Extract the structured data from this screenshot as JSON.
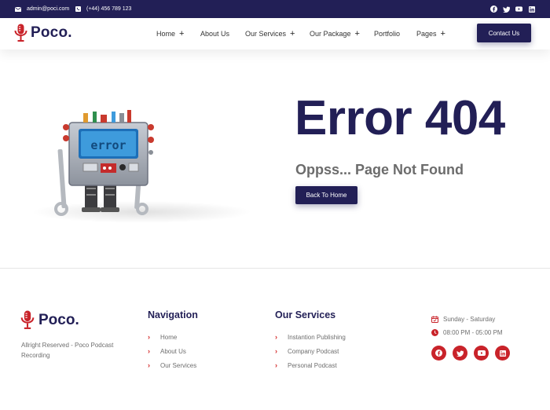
{
  "topbar": {
    "email": "admin@poci.com",
    "phone": "(+44) 456 789 123",
    "social_icons": [
      "facebook-icon",
      "twitter-icon",
      "youtube-icon",
      "linkedin-icon"
    ]
  },
  "header": {
    "brand": "Poco.",
    "nav": [
      {
        "label": "Home",
        "has_dropdown": true
      },
      {
        "label": "About Us",
        "has_dropdown": false
      },
      {
        "label": "Our Services",
        "has_dropdown": true
      },
      {
        "label": "Our Package",
        "has_dropdown": true
      },
      {
        "label": "Portfolio",
        "has_dropdown": false
      },
      {
        "label": "Pages",
        "has_dropdown": true
      }
    ],
    "cta_label": "Contact Us"
  },
  "hero": {
    "title": "Error 404",
    "subtitle": "Oppss... Page Not Found",
    "button_label": "Back To Home",
    "robot_screen_text": "error"
  },
  "footer": {
    "brand": "Poco.",
    "copyright": "Allright Reserved - Poco Podcast Recording",
    "navigation": {
      "heading": "Navigation",
      "items": [
        "Home",
        "About Us",
        "Our Services"
      ]
    },
    "services": {
      "heading": "Our Services",
      "items": [
        "Instantion Publishing",
        "Company Podcast",
        "Personal Podcast"
      ]
    },
    "hours": {
      "days": "Sunday - Saturday",
      "time": "08:00 PM - 05:00 PM"
    },
    "social_icons": [
      "facebook-icon",
      "twitter-icon",
      "youtube-icon",
      "linkedin-icon"
    ]
  },
  "colors": {
    "navy": "#221f56",
    "red": "#c9232a",
    "muted_text": "#6e6e6e"
  }
}
